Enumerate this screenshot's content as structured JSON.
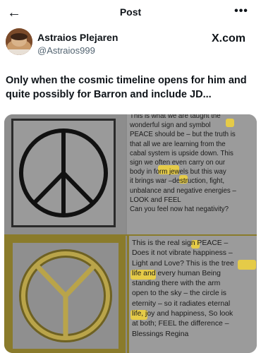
{
  "header": {
    "title": "Post",
    "back_icon": "arrow-left-icon",
    "more_icon": "more-dots-icon"
  },
  "author": {
    "name": "Astraios Plejaren",
    "handle": "@Astraios999",
    "source": "X.com"
  },
  "post": {
    "text": "Only when the cosmic timeline opens for him and quite possibly for Barron and include JD..."
  },
  "image": {
    "top_text": "This is what we are taught the\nwonderful sign and symbol\nPEACE should be – but the truth is\nthat all we are learning from the\ncabal system is upside down. This\nsign we often even carry on our\nbody in form  jewels but this way\nit brings war –destruction, fight,\nunbalance and negative energies –\nLOOK and FEEL\nCan you feel now hat negativity?",
    "bottom_text": "This is the real sign  PEACE –\nDoes it not vibrate happiness –\nLight and Love? This is the tree\n  life and every human Being\nstanding there with the arm\nopen to the sky – the circle is\neternity – so it radiates eternal\nlife, joy and happiness, So look\nat both; FEEL the difference –\nBlessings Regina",
    "highlight_color": "#f2d43a",
    "frame_color": "#8a7b2b"
  }
}
